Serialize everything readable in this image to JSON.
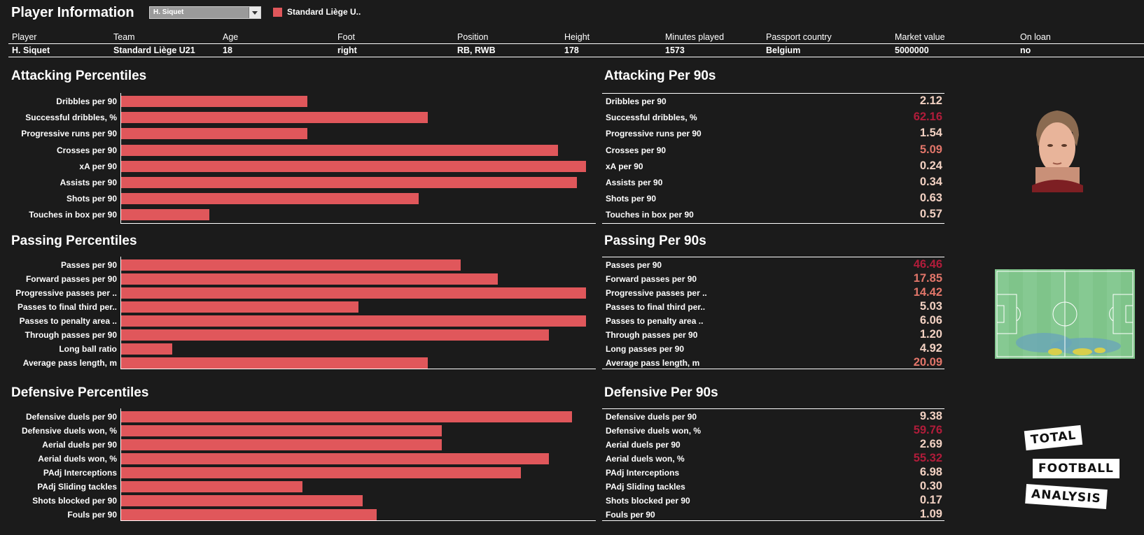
{
  "header": {
    "title": "Player Information",
    "dropdown_value": "H. Siquet",
    "legend_label": "Standard Liège U.."
  },
  "info": {
    "headers": [
      "Player",
      "Team",
      "Age",
      "Foot",
      "Position",
      "Height",
      "Minutes played",
      "Passport country",
      "Market value",
      "On loan"
    ],
    "values": [
      "H. Siquet",
      "Standard Liège U21",
      "18",
      "right",
      "RB, RWB",
      "178",
      "1573",
      "Belgium",
      "5000000",
      "no"
    ]
  },
  "colors": {
    "bar": "#e0575b",
    "background": "#1b1b1b",
    "val_high": "#b01c3a",
    "val_mid": "#e2766a",
    "val_low": "#f2d1c2"
  },
  "sections": {
    "attacking": {
      "percentiles_title": "Attacking Percentiles",
      "per90_title": "Attacking Per 90s",
      "labels": [
        "Dribbles per 90",
        "Successful dribbles, %",
        "Progressive runs per 90",
        "Crosses per 90",
        "xA per 90",
        "Assists per 90",
        "Shots per 90",
        "Touches in box per 90"
      ],
      "percentiles": [
        40,
        66,
        40,
        94,
        100,
        98,
        64,
        19
      ],
      "values": [
        "2.12",
        "62.16",
        "1.54",
        "5.09",
        "0.24",
        "0.34",
        "0.63",
        "0.57"
      ],
      "value_tone": [
        "low",
        "high",
        "low",
        "mid",
        "low",
        "low",
        "low",
        "low"
      ]
    },
    "passing": {
      "percentiles_title": "Passing Percentiles",
      "per90_title": "Passing Per 90s",
      "labels": [
        "Passes per 90",
        "Forward passes per 90",
        "Progressive passes per ..",
        "Passes to final third per..",
        "Passes to penalty area ..",
        "Through passes per 90",
        "Long ball ratio",
        "Average pass length, m"
      ],
      "value_labels": [
        "Passes per 90",
        "Forward passes per 90",
        "Progressive passes per ..",
        "Passes to final third per..",
        "Passes to penalty area ..",
        "Through passes per 90",
        "Long passes per 90",
        "Average pass length, m"
      ],
      "percentiles": [
        73,
        81,
        100,
        51,
        100,
        92,
        11,
        66
      ],
      "values": [
        "46.46",
        "17.85",
        "14.42",
        "5.03",
        "6.06",
        "1.20",
        "4.92",
        "20.09"
      ],
      "value_tone": [
        "high",
        "mid",
        "mid",
        "low",
        "low",
        "low",
        "low",
        "mid"
      ]
    },
    "defensive": {
      "percentiles_title": "Defensive Percentiles",
      "per90_title": "Defensive Per 90s",
      "labels": [
        "Defensive duels per 90",
        "Defensive duels won, %",
        "Aerial duels per 90",
        "Aerial duels won, %",
        "PAdj Interceptions",
        "PAdj Sliding tackles",
        "Shots blocked per 90",
        "Fouls per 90"
      ],
      "percentiles": [
        97,
        69,
        69,
        92,
        86,
        39,
        52,
        55
      ],
      "values": [
        "9.38",
        "59.76",
        "2.69",
        "55.32",
        "6.98",
        "0.30",
        "0.17",
        "1.09"
      ],
      "value_tone": [
        "low",
        "high",
        "low",
        "high",
        "low",
        "low",
        "low",
        "low"
      ]
    }
  },
  "logo": {
    "line1": "TOTAL",
    "line2": "FOOTBALL",
    "line3": "ANALYSIS"
  }
}
